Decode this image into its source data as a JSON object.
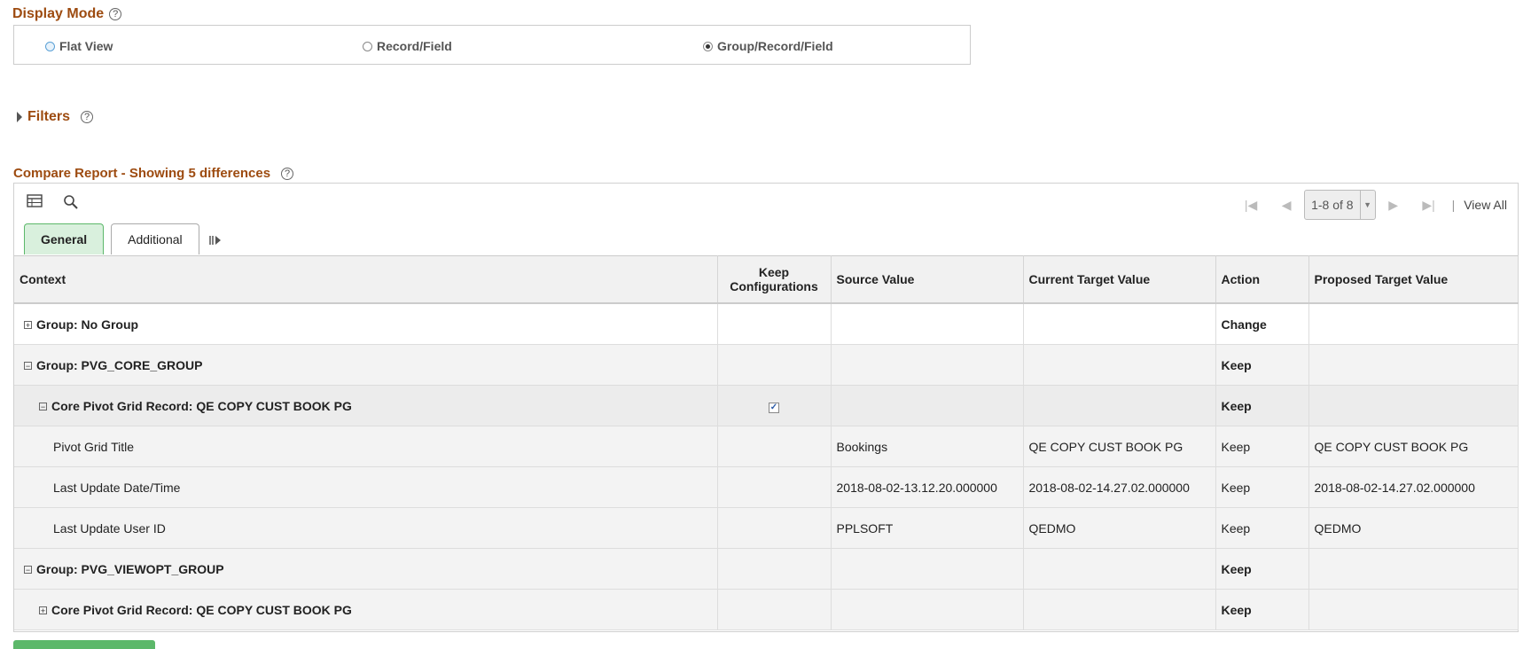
{
  "display_mode": {
    "title": "Display Mode",
    "help": "?",
    "options": [
      {
        "label": "Flat View",
        "selected": false
      },
      {
        "label": "Record/Field",
        "selected": false
      },
      {
        "label": "Group/Record/Field",
        "selected": true
      }
    ]
  },
  "filters": {
    "title": "Filters",
    "help": "?"
  },
  "report": {
    "title": "Compare Report - Showing 5 differences",
    "help": "?",
    "pager": {
      "count": "1-8 of 8",
      "view_all": "View All"
    },
    "tabs": [
      "General",
      "Additional"
    ],
    "columns": [
      "Context",
      "Keep Configurations",
      "Source Value",
      "Current Target Value",
      "Action",
      "Proposed Target Value"
    ],
    "rows": [
      {
        "context": "Group: No Group",
        "keep": false,
        "source": "",
        "current": "",
        "action": "Change",
        "proposed": ""
      },
      {
        "context": "Group: PVG_CORE_GROUP",
        "keep": false,
        "source": "",
        "current": "",
        "action": "Keep",
        "proposed": ""
      },
      {
        "context": "Core Pivot Grid Record: QE COPY CUST BOOK PG",
        "keep": true,
        "source": "",
        "current": "",
        "action": "Keep",
        "proposed": ""
      },
      {
        "context": "Pivot Grid Title",
        "keep": false,
        "source": "Bookings",
        "current": "QE COPY CUST BOOK PG",
        "action": "Keep",
        "proposed": "QE COPY CUST BOOK PG"
      },
      {
        "context": "Last Update Date/Time",
        "keep": false,
        "source": "2018-08-02-13.12.20.000000",
        "current": "2018-08-02-14.27.02.000000",
        "action": "Keep",
        "proposed": "2018-08-02-14.27.02.000000"
      },
      {
        "context": "Last Update User ID",
        "keep": false,
        "source": "PPLSOFT",
        "current": "QEDMO",
        "action": "Keep",
        "proposed": "QEDMO"
      },
      {
        "context": "Group: PVG_VIEWOPT_GROUP",
        "keep": false,
        "source": "",
        "current": "",
        "action": "Keep",
        "proposed": ""
      },
      {
        "context": "Core Pivot Grid Record: QE COPY CUST BOOK PG",
        "keep": false,
        "source": "",
        "current": "",
        "action": "Keep",
        "proposed": ""
      }
    ]
  }
}
